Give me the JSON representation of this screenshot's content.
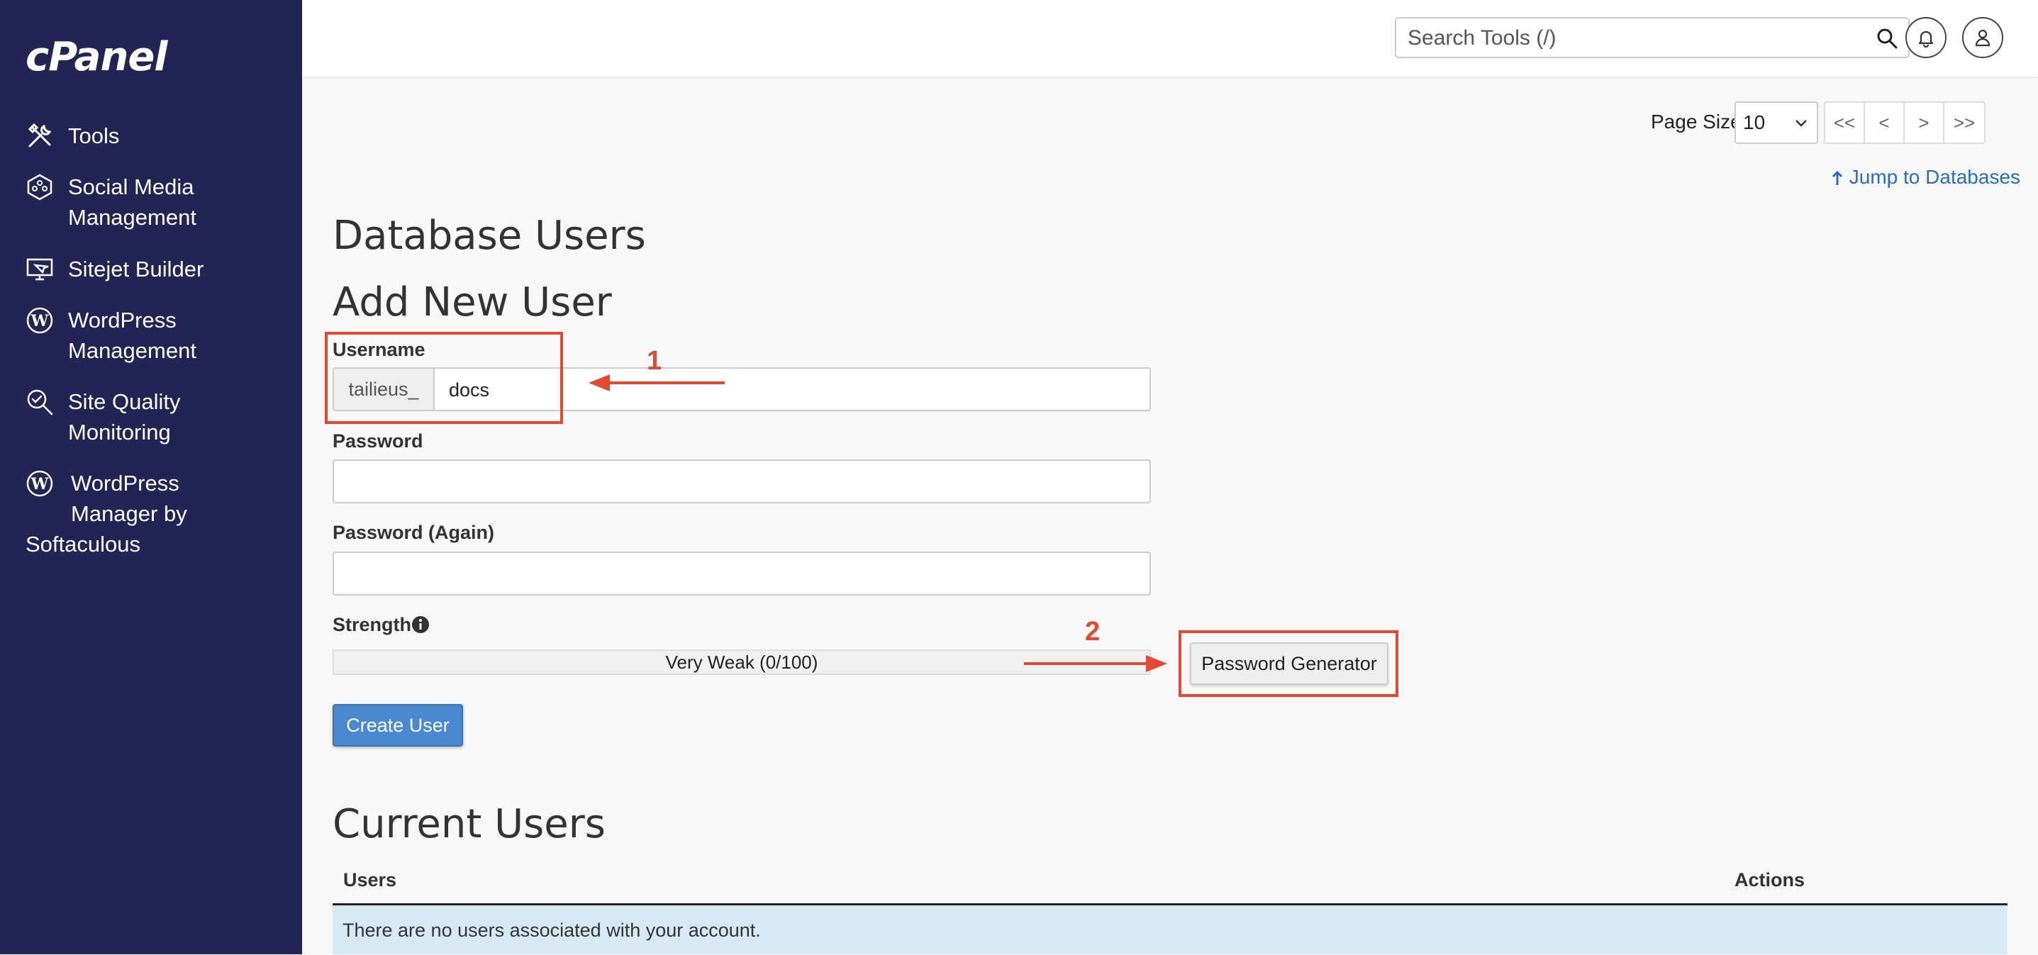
{
  "sidebar": {
    "logo": "cPanel",
    "items": [
      {
        "label": "Tools",
        "icon": "tools-icon"
      },
      {
        "label": "Social Media\nManagement",
        "icon": "social-media-icon"
      },
      {
        "label": "Sitejet Builder",
        "icon": "sitejet-icon"
      },
      {
        "label": "WordPress\nManagement",
        "icon": "wordpress-icon"
      },
      {
        "label": "Site Quality\nMonitoring",
        "icon": "site-quality-icon"
      },
      {
        "label": "WordPress\nManager by",
        "label_tail": "Softaculous",
        "icon": "wordpress-icon"
      }
    ]
  },
  "header": {
    "search_placeholder": "Search Tools (/)",
    "icons": [
      "search-icon",
      "bell-icon",
      "user-icon"
    ]
  },
  "pagination": {
    "page_size_label": "Page Size",
    "page_size_value": "10",
    "buttons": [
      "<<",
      "<",
      ">",
      ">>"
    ]
  },
  "jump_link": "Jump to Databases",
  "page_title": "Database Users",
  "form": {
    "title": "Add New User",
    "username_label": "Username",
    "username_prefix": "tailieus_",
    "username_value": "docs",
    "password_label": "Password",
    "password_again_label": "Password (Again)",
    "strength_label": "Strength",
    "strength_value": "Very Weak (0/100)",
    "generator_button": "Password Generator",
    "create_button": "Create User"
  },
  "current_users": {
    "title": "Current Users",
    "columns": [
      "Users",
      "Actions"
    ],
    "empty_message": "There are no users associated with your account."
  },
  "annotations": {
    "step1": "1",
    "step2": "2",
    "color": "#e04a32"
  },
  "colors": {
    "sidebar_bg": "#222553",
    "primary_button": "#4a89d0",
    "link": "#2a6eb8",
    "empty_row_bg": "#d6e9f5"
  }
}
